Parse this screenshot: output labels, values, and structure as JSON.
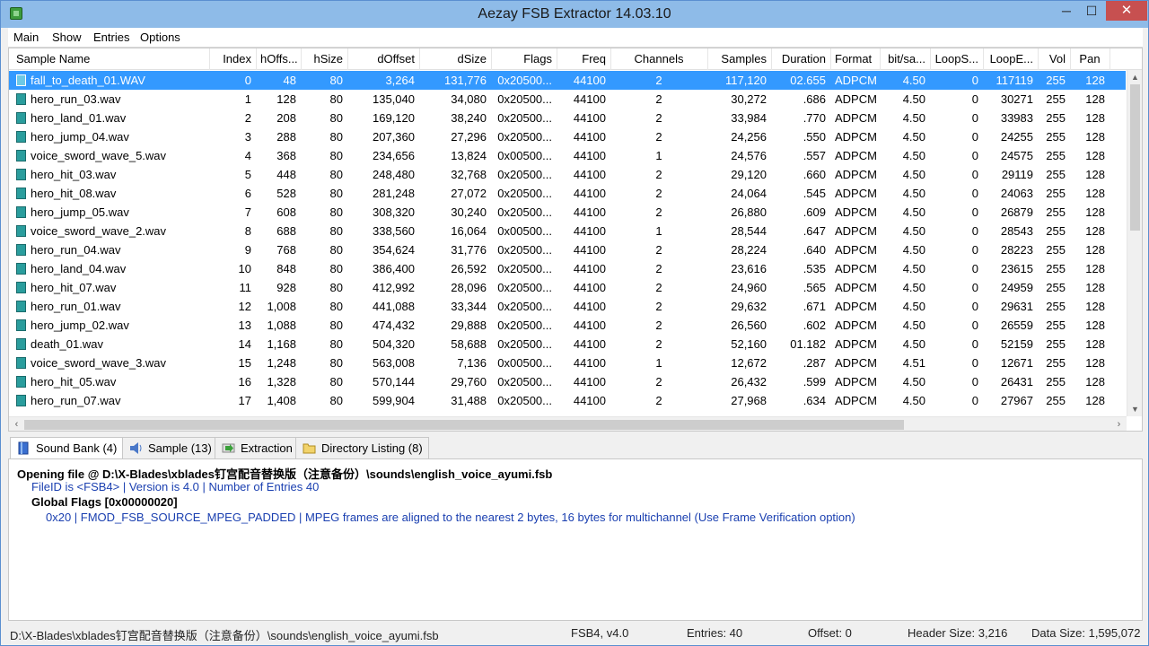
{
  "window": {
    "title": "Aezay FSB Extractor 14.03.10",
    "minimize": "─",
    "maximize": "☐",
    "close": "✕"
  },
  "menu": [
    "Main",
    "Show",
    "Entries",
    "Options"
  ],
  "columns": [
    "Sample Name",
    "Index",
    "hOffs...",
    "hSize",
    "dOffset",
    "dSize",
    "Flags",
    "Freq",
    "Channels",
    "Samples",
    "Duration",
    "Format",
    "bit/sa...",
    "LoopS...",
    "LoopE...",
    "Vol",
    "Pan"
  ],
  "rows": [
    [
      "fall_to_death_01.WAV",
      "0",
      "48",
      "80",
      "3,264",
      "131,776",
      "0x20500...",
      "44100",
      "2",
      "117,120",
      "02.655",
      "ADPCM",
      "4.50",
      "0",
      "117119",
      "255",
      "128"
    ],
    [
      "hero_run_03.wav",
      "1",
      "128",
      "80",
      "135,040",
      "34,080",
      "0x20500...",
      "44100",
      "2",
      "30,272",
      ".686",
      "ADPCM",
      "4.50",
      "0",
      "30271",
      "255",
      "128"
    ],
    [
      "hero_land_01.wav",
      "2",
      "208",
      "80",
      "169,120",
      "38,240",
      "0x20500...",
      "44100",
      "2",
      "33,984",
      ".770",
      "ADPCM",
      "4.50",
      "0",
      "33983",
      "255",
      "128"
    ],
    [
      "hero_jump_04.wav",
      "3",
      "288",
      "80",
      "207,360",
      "27,296",
      "0x20500...",
      "44100",
      "2",
      "24,256",
      ".550",
      "ADPCM",
      "4.50",
      "0",
      "24255",
      "255",
      "128"
    ],
    [
      "voice_sword_wave_5.wav",
      "4",
      "368",
      "80",
      "234,656",
      "13,824",
      "0x00500...",
      "44100",
      "1",
      "24,576",
      ".557",
      "ADPCM",
      "4.50",
      "0",
      "24575",
      "255",
      "128"
    ],
    [
      "hero_hit_03.wav",
      "5",
      "448",
      "80",
      "248,480",
      "32,768",
      "0x20500...",
      "44100",
      "2",
      "29,120",
      ".660",
      "ADPCM",
      "4.50",
      "0",
      "29119",
      "255",
      "128"
    ],
    [
      "hero_hit_08.wav",
      "6",
      "528",
      "80",
      "281,248",
      "27,072",
      "0x20500...",
      "44100",
      "2",
      "24,064",
      ".545",
      "ADPCM",
      "4.50",
      "0",
      "24063",
      "255",
      "128"
    ],
    [
      "hero_jump_05.wav",
      "7",
      "608",
      "80",
      "308,320",
      "30,240",
      "0x20500...",
      "44100",
      "2",
      "26,880",
      ".609",
      "ADPCM",
      "4.50",
      "0",
      "26879",
      "255",
      "128"
    ],
    [
      "voice_sword_wave_2.wav",
      "8",
      "688",
      "80",
      "338,560",
      "16,064",
      "0x00500...",
      "44100",
      "1",
      "28,544",
      ".647",
      "ADPCM",
      "4.50",
      "0",
      "28543",
      "255",
      "128"
    ],
    [
      "hero_run_04.wav",
      "9",
      "768",
      "80",
      "354,624",
      "31,776",
      "0x20500...",
      "44100",
      "2",
      "28,224",
      ".640",
      "ADPCM",
      "4.50",
      "0",
      "28223",
      "255",
      "128"
    ],
    [
      "hero_land_04.wav",
      "10",
      "848",
      "80",
      "386,400",
      "26,592",
      "0x20500...",
      "44100",
      "2",
      "23,616",
      ".535",
      "ADPCM",
      "4.50",
      "0",
      "23615",
      "255",
      "128"
    ],
    [
      "hero_hit_07.wav",
      "11",
      "928",
      "80",
      "412,992",
      "28,096",
      "0x20500...",
      "44100",
      "2",
      "24,960",
      ".565",
      "ADPCM",
      "4.50",
      "0",
      "24959",
      "255",
      "128"
    ],
    [
      "hero_run_01.wav",
      "12",
      "1,008",
      "80",
      "441,088",
      "33,344",
      "0x20500...",
      "44100",
      "2",
      "29,632",
      ".671",
      "ADPCM",
      "4.50",
      "0",
      "29631",
      "255",
      "128"
    ],
    [
      "hero_jump_02.wav",
      "13",
      "1,088",
      "80",
      "474,432",
      "29,888",
      "0x20500...",
      "44100",
      "2",
      "26,560",
      ".602",
      "ADPCM",
      "4.50",
      "0",
      "26559",
      "255",
      "128"
    ],
    [
      "death_01.wav",
      "14",
      "1,168",
      "80",
      "504,320",
      "58,688",
      "0x20500...",
      "44100",
      "2",
      "52,160",
      "01.182",
      "ADPCM",
      "4.50",
      "0",
      "52159",
      "255",
      "128"
    ],
    [
      "voice_sword_wave_3.wav",
      "15",
      "1,248",
      "80",
      "563,008",
      "7,136",
      "0x00500...",
      "44100",
      "1",
      "12,672",
      ".287",
      "ADPCM",
      "4.51",
      "0",
      "12671",
      "255",
      "128"
    ],
    [
      "hero_hit_05.wav",
      "16",
      "1,328",
      "80",
      "570,144",
      "29,760",
      "0x20500...",
      "44100",
      "2",
      "26,432",
      ".599",
      "ADPCM",
      "4.50",
      "0",
      "26431",
      "255",
      "128"
    ],
    [
      "hero_run_07.wav",
      "17",
      "1,408",
      "80",
      "599,904",
      "31,488",
      "0x20500...",
      "44100",
      "2",
      "27,968",
      ".634",
      "ADPCM",
      "4.50",
      "0",
      "27967",
      "255",
      "128"
    ]
  ],
  "selected_row": 0,
  "tabs": [
    {
      "label": "Sound Bank (4)",
      "icon": "book-icon"
    },
    {
      "label": "Sample (13)",
      "icon": "speaker-icon"
    },
    {
      "label": "Extraction",
      "icon": "arrow-right-icon"
    },
    {
      "label": "Directory Listing (8)",
      "icon": "folder-icon"
    }
  ],
  "log": {
    "line1_label": "Opening file  @  D:\\X-Blades\\xblades钉宫配音替换版（注意备份）\\sounds\\english_voice_ayumi.fsb",
    "line2": "FileID is <FSB4>  |  Version is 4.0  |  Number of Entries 40",
    "line3": "Global Flags [0x00000020]",
    "line4": "0x20  |  FMOD_FSB_SOURCE_MPEG_PADDED  |  MPEG frames are aligned to the nearest 2 bytes, 16 bytes for multichannel (Use Frame Verification option)"
  },
  "status": {
    "path": "D:\\X-Blades\\xblades钉宫配音替换版（注意备份）\\sounds\\english_voice_ayumi.fsb",
    "format": "FSB4, v4.0",
    "entries": "Entries: 40",
    "offset": "Offset: 0",
    "header_size": "Header Size: 3,216",
    "data_size": "Data Size: 1,595,072"
  }
}
